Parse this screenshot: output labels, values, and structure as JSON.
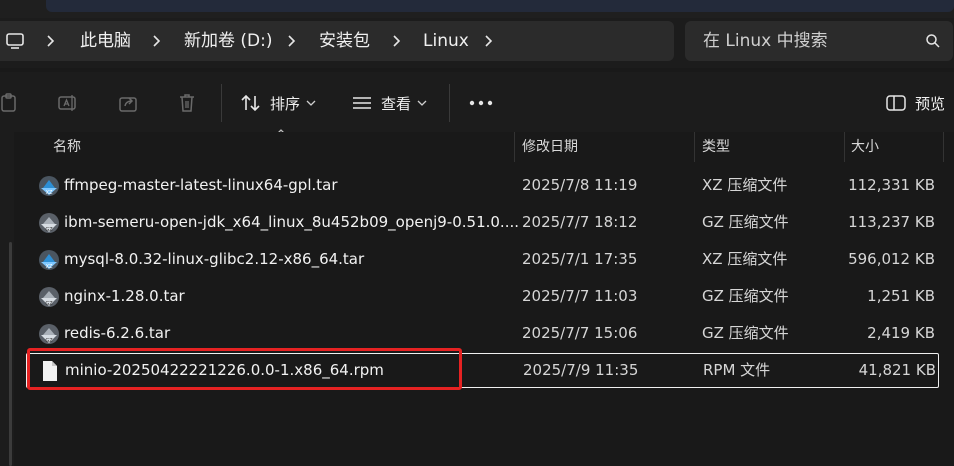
{
  "breadcrumb": {
    "items": [
      "此电脑",
      "新加卷 (D:)",
      "安装包",
      "Linux"
    ]
  },
  "search": {
    "placeholder": "在 Linux 中搜索"
  },
  "toolbar": {
    "sort_label": "排序",
    "view_label": "查看",
    "preview_label": "预览"
  },
  "columns": {
    "name": "名称",
    "modified": "修改日期",
    "type": "类型",
    "size": "大小"
  },
  "files": [
    {
      "name": "ffmpeg-master-latest-linux64-gpl.tar",
      "modified": "2025/7/8 11:19",
      "type": "XZ 压缩文件",
      "size": "112,331 KB",
      "icon": "xz-archive-icon"
    },
    {
      "name": "ibm-semeru-open-jdk_x64_linux_8u452b09_openj9-0.51.0....",
      "modified": "2025/7/7 18:12",
      "type": "GZ 压缩文件",
      "size": "113,237 KB",
      "icon": "gz-archive-icon"
    },
    {
      "name": "mysql-8.0.32-linux-glibc2.12-x86_64.tar",
      "modified": "2025/7/1 17:35",
      "type": "XZ 压缩文件",
      "size": "596,012 KB",
      "icon": "xz-archive-icon"
    },
    {
      "name": "nginx-1.28.0.tar",
      "modified": "2025/7/7 11:03",
      "type": "GZ 压缩文件",
      "size": "1,251 KB",
      "icon": "gz-archive-icon"
    },
    {
      "name": "redis-6.2.6.tar",
      "modified": "2025/7/7 15:06",
      "type": "GZ 压缩文件",
      "size": "2,419 KB",
      "icon": "gz-archive-icon"
    },
    {
      "name": "minio-20250422221226.0.0-1.x86_64.rpm",
      "modified": "2025/7/9 11:35",
      "type": "RPM 文件",
      "size": "41,821 KB",
      "icon": "file-icon"
    }
  ],
  "colors": {
    "highlight": "#e62222",
    "background": "#191919"
  }
}
